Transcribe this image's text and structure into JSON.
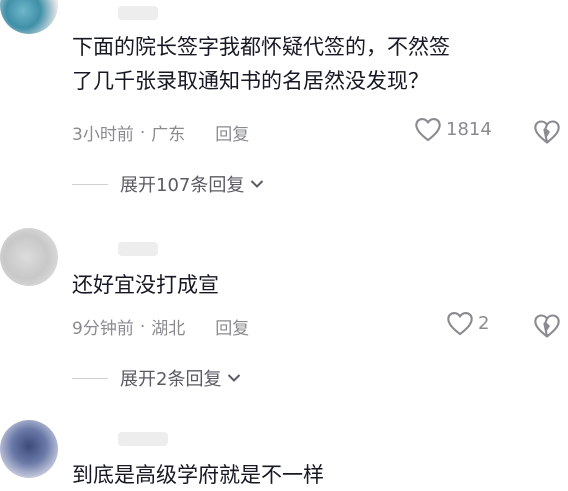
{
  "comments": [
    {
      "text_lines": [
        "下面的院长签字我都怀疑代签的，不然签",
        "了几千张录取通知书的名居然没发现？"
      ],
      "time": "3小时前",
      "location": "广东",
      "reply_label": "回复",
      "likes": "1814",
      "expand_label": "展开107条回复"
    },
    {
      "text_lines": [
        "还好宜没打成宣"
      ],
      "time": "9分钟前",
      "location": "湖北",
      "reply_label": "回复",
      "likes": "2",
      "expand_label": "展开2条回复"
    },
    {
      "text_lines": [
        "到底是高级学府就是不一样"
      ]
    }
  ],
  "meta_separator": "·",
  "colors": {
    "text": "#161823",
    "meta": "#8a8b91",
    "icon": "#8a8b91"
  },
  "icons": {
    "like": "heart-outline-icon",
    "dislike": "broken-heart-icon",
    "expand": "chevron-down-icon"
  }
}
